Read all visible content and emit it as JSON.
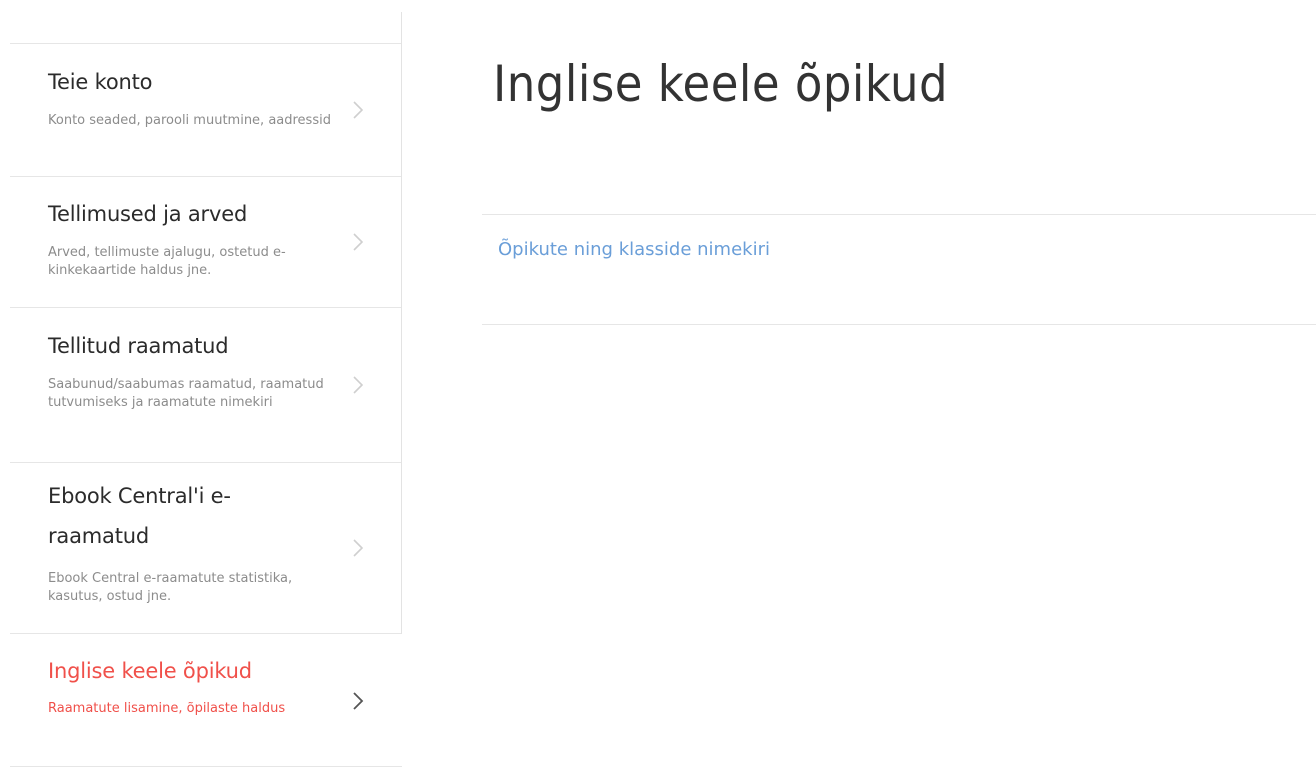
{
  "sidebar": {
    "items": [
      {
        "title": "Teie konto",
        "description": "Konto seaded, parooli muutmine, aadressid",
        "icon": "chevron-right-icon",
        "active": false
      },
      {
        "title": "Tellimused ja arved",
        "description": "Arved, tellimuste ajalugu, ostetud e-kinkekaartide haldus jne.",
        "icon": "chevron-right-icon",
        "active": false
      },
      {
        "title": "Tellitud raamatud",
        "description": "Saabunud/saabumas raamatud, raamatud tutvumiseks ja raamatute nimekiri",
        "icon": "chevron-right-icon",
        "active": false
      },
      {
        "title": "Ebook Central'i e-raamatud",
        "description": "Ebook Central e-raamatute statistika, kasutus, ostud jne.",
        "icon": "chevron-right-icon",
        "active": false
      },
      {
        "title": "Inglise keele õpikud",
        "description": "Raamatute lisamine, õpilaste haldus",
        "icon": "chevron-right-icon",
        "active": true
      }
    ]
  },
  "main": {
    "title": "Inglise keele õpikud",
    "link_label": "Õpikute ning klasside nimekiri"
  },
  "colors": {
    "accent": "#f0504a",
    "link": "#6a9ed8",
    "text": "#2b2b2b",
    "muted": "#8c8c8c",
    "divider": "#e6e6e6"
  }
}
